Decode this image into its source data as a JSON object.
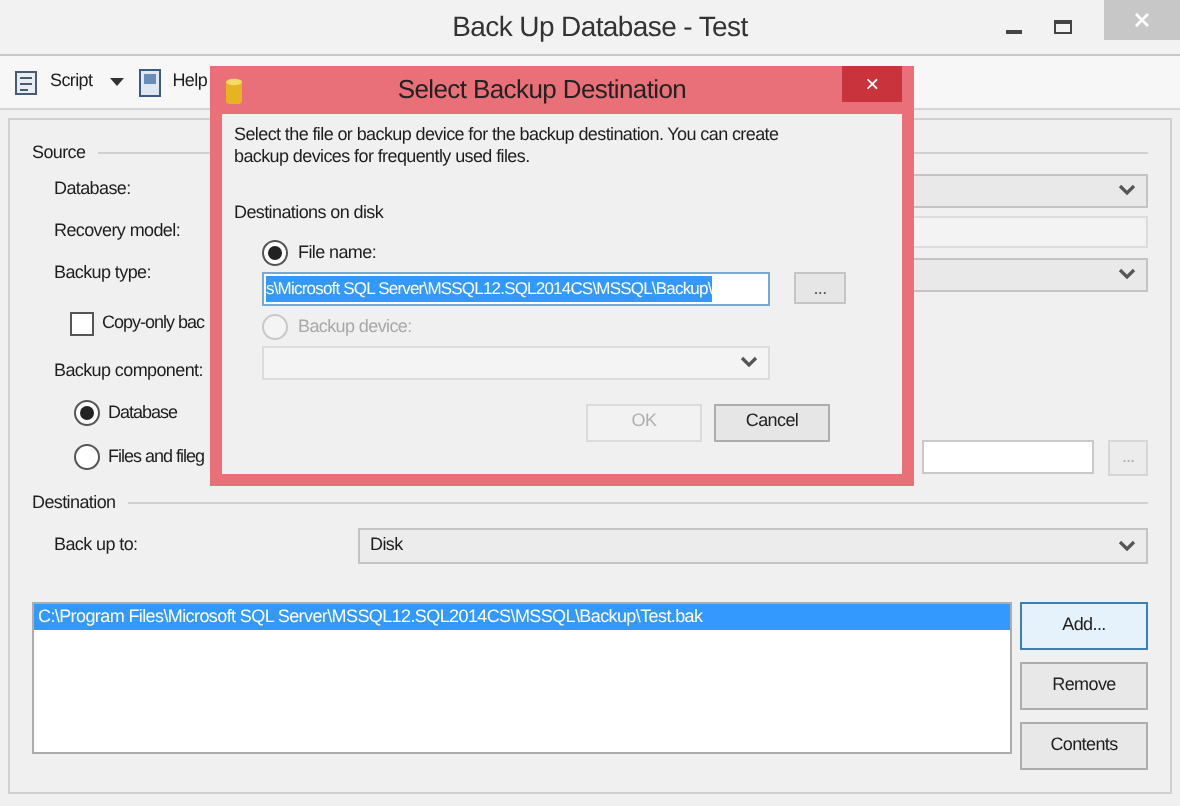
{
  "window": {
    "title": "Back Up Database - Test"
  },
  "toolbar": [
    {
      "kind": "script",
      "label": "Script"
    },
    {
      "kind": "help",
      "label": "Help"
    }
  ],
  "source": {
    "title": "Source",
    "database_label": "Database:",
    "recovery_model_label": "Recovery model:",
    "backup_type_label": "Backup type:",
    "copy_only": {
      "label": "Copy-only bac",
      "checked": false
    },
    "backup_component_label": "Backup component:",
    "components": [
      {
        "label": "Database",
        "selected": true
      },
      {
        "label": "Files and fileg",
        "selected": false
      }
    ],
    "files_browse": "..."
  },
  "destination": {
    "title": "Destination",
    "back_up_to_label": "Back up to:",
    "back_up_to_value": "Disk",
    "paths": [
      {
        "text": "C:\\Program Files\\Microsoft SQL Server\\MSSQL12.SQL2014CS\\MSSQL\\Backup\\Test.bak",
        "selected": true
      }
    ],
    "buttons": [
      "Add...",
      "Remove",
      "Contents"
    ]
  },
  "dialog": {
    "title": "Select Backup Destination",
    "close": "×",
    "description": "Select the file or backup device for the backup destination. You can create backup devices for frequently used files.",
    "section": "Destinations on disk",
    "options": [
      {
        "label": "File name:",
        "selected": true,
        "disabled": false
      },
      {
        "label": "Backup device:",
        "selected": false,
        "disabled": true
      }
    ],
    "file_name_value": "s\\Microsoft SQL Server\\MSSQL12.SQL2014CS\\MSSQL\\Backup\\",
    "browse": "...",
    "buttons": [
      {
        "label": "OK",
        "disabled": true
      },
      {
        "label": "Cancel",
        "disabled": false
      }
    ]
  }
}
